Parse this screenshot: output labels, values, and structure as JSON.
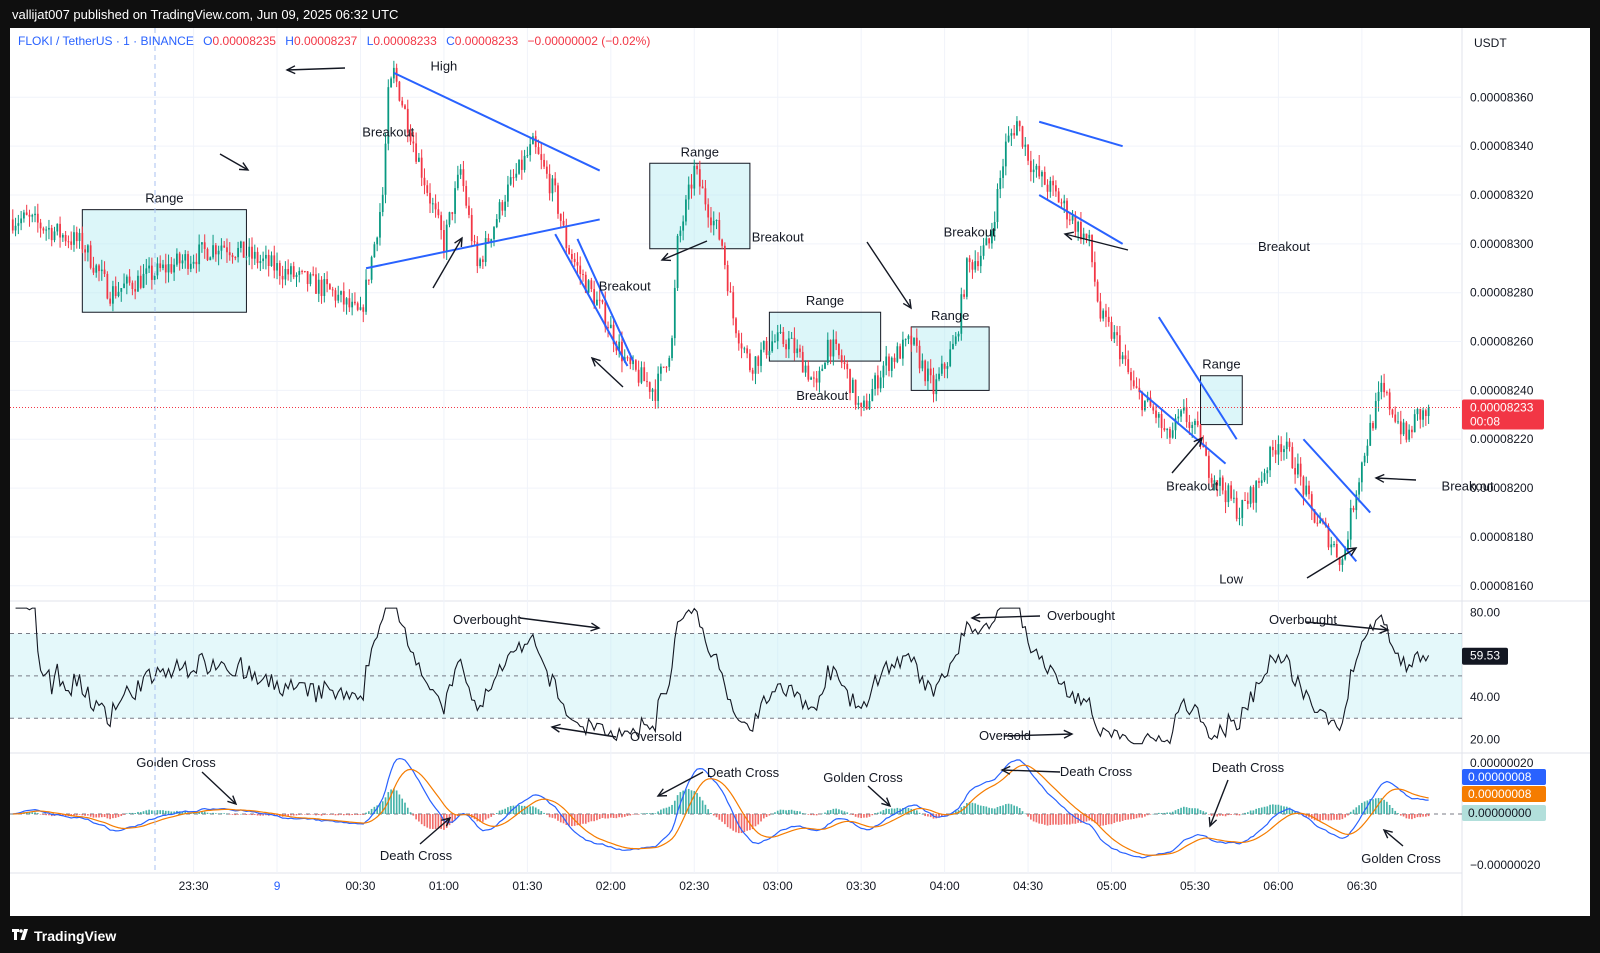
{
  "header": {
    "published_by": "vallijat007 published on TradingView.com, Jun 09, 2025 06:32 UTC"
  },
  "legend": {
    "symbol": "FLOKI / TetherUS · 1 · BINANCE",
    "open_label": "O",
    "open": "0.00008235",
    "high_label": "H",
    "high": "0.00008237",
    "low_label": "L",
    "low": "0.00008233",
    "close_label": "C",
    "close": "0.00008233",
    "change": "−0.00000002 (−0.02%)",
    "up_color": "#089981",
    "down_color": "#f23645",
    "symbol_color": "#2962ff"
  },
  "currency": "USDT",
  "price_badge": {
    "price": "0.00008233",
    "countdown": "00:08",
    "color": "#f23645"
  },
  "rsi_badge": {
    "value": "59.53"
  },
  "macd_badges": [
    {
      "value": "0.00000008",
      "color": "#2962ff"
    },
    {
      "value": "0.00000008",
      "color": "#f57c00"
    },
    {
      "value": "0.00000000",
      "color": "#b2dfdb"
    }
  ],
  "footer": {
    "brand": "TradingView"
  },
  "chart_data": [
    {
      "type": "candlestick",
      "name": "price",
      "y_ticks": [
        "0.00008360",
        "0.00008340",
        "0.00008320",
        "0.00008300",
        "0.00008280",
        "0.00008260",
        "0.00008240",
        "0.00008220",
        "0.00008200",
        "0.00008180",
        "0.00008160"
      ],
      "ylim": [
        8.155e-05,
        8.372e-05
      ],
      "x_ticks": [
        "23:30",
        "9",
        "00:30",
        "01:00",
        "01:30",
        "02:00",
        "02:30",
        "03:00",
        "03:30",
        "04:00",
        "04:30",
        "05:00",
        "05:30",
        "06:00",
        "06:30"
      ],
      "x_tick_minutes": [
        -30,
        0,
        30,
        60,
        90,
        120,
        150,
        180,
        210,
        240,
        270,
        300,
        330,
        360,
        390
      ],
      "last_price": 8.233e-05,
      "path_keypoints": [
        [
          -90,
          8.31e-05
        ],
        [
          -70,
          8.3e-05
        ],
        [
          -60,
          8.28e-05
        ],
        [
          -40,
          8.29e-05
        ],
        [
          -20,
          8.3e-05
        ],
        [
          0,
          8.29e-05
        ],
        [
          20,
          8.28e-05
        ],
        [
          30,
          8.27e-05
        ],
        [
          35,
          8.3e-05
        ],
        [
          38,
          8.32e-05
        ],
        [
          40,
          8.36e-05
        ],
        [
          42,
          8.37e-05
        ],
        [
          52,
          8.33e-05
        ],
        [
          60,
          8.3e-05
        ],
        [
          66,
          8.33e-05
        ],
        [
          72,
          8.29e-05
        ],
        [
          82,
          8.32e-05
        ],
        [
          92,
          8.34e-05
        ],
        [
          100,
          8.32e-05
        ],
        [
          104,
          8.3e-05
        ],
        [
          108,
          8.29e-05
        ],
        [
          118,
          8.27e-05
        ],
        [
          126,
          8.25e-05
        ],
        [
          136,
          8.24e-05
        ],
        [
          142,
          8.26e-05
        ],
        [
          144,
          8.3e-05
        ],
        [
          150,
          8.33e-05
        ],
        [
          160,
          8.3e-05
        ],
        [
          164,
          8.27e-05
        ],
        [
          170,
          8.25e-05
        ],
        [
          178,
          8.26e-05
        ],
        [
          184,
          8.26e-05
        ],
        [
          190,
          8.25e-05
        ],
        [
          194,
          8.24e-05
        ],
        [
          198,
          8.26e-05
        ],
        [
          204,
          8.25e-05
        ],
        [
          210,
          8.23e-05
        ],
        [
          218,
          8.25e-05
        ],
        [
          228,
          8.26e-05
        ],
        [
          236,
          8.24e-05
        ],
        [
          244,
          8.26e-05
        ],
        [
          248,
          8.29e-05
        ],
        [
          256,
          8.3e-05
        ],
        [
          262,
          8.34e-05
        ],
        [
          266,
          8.35e-05
        ],
        [
          272,
          8.33e-05
        ],
        [
          280,
          8.32e-05
        ],
        [
          286,
          8.31e-05
        ],
        [
          292,
          8.3e-05
        ],
        [
          296,
          8.27e-05
        ],
        [
          302,
          8.26e-05
        ],
        [
          308,
          8.24e-05
        ],
        [
          316,
          8.23e-05
        ],
        [
          320,
          8.22e-05
        ],
        [
          326,
          8.23e-05
        ],
        [
          332,
          8.22e-05
        ],
        [
          334,
          8.21e-05
        ],
        [
          340,
          8.2e-05
        ],
        [
          346,
          8.19e-05
        ],
        [
          352,
          8.2e-05
        ],
        [
          360,
          8.22e-05
        ],
        [
          366,
          8.21e-05
        ],
        [
          372,
          8.19e-05
        ],
        [
          378,
          8.18e-05
        ],
        [
          383,
          8.17e-05
        ],
        [
          388,
          8.2e-05
        ],
        [
          392,
          8.22e-05
        ],
        [
          397,
          8.24e-05
        ],
        [
          402,
          8.23e-05
        ],
        [
          406,
          8.22e-05
        ],
        [
          410,
          8.23e-05
        ],
        [
          414,
          8.23e-05
        ]
      ],
      "annotations": [
        {
          "text": "Range",
          "kind": "box",
          "t": [
            -70,
            -11
          ],
          "p": [
            8.272e-05,
            8.314e-05
          ]
        },
        {
          "text": "High",
          "kind": "label",
          "t": 60,
          "p": 8.371e-05
        },
        {
          "text": "Breakout",
          "kind": "label",
          "t": 40,
          "p": 8.344e-05
        },
        {
          "text": "Breakout",
          "kind": "label",
          "t": 125,
          "p": 8.281e-05
        },
        {
          "text": "Range",
          "kind": "box",
          "t": [
            134,
            170
          ],
          "p": [
            8.298e-05,
            8.333e-05
          ]
        },
        {
          "text": "Breakout",
          "kind": "label",
          "t": 180,
          "p": 8.301e-05
        },
        {
          "text": "Breakout",
          "kind": "label",
          "t": 196,
          "p": 8.236e-05
        },
        {
          "text": "Range",
          "kind": "box",
          "t": [
            177,
            217
          ],
          "p": [
            8.252e-05,
            8.272e-05
          ]
        },
        {
          "text": "Breakout",
          "kind": "label",
          "t": 249,
          "p": 8.303e-05
        },
        {
          "text": "Range",
          "kind": "box",
          "t": [
            228,
            256
          ],
          "p": [
            8.24e-05,
            8.266e-05
          ]
        },
        {
          "text": "Breakout",
          "kind": "label",
          "t": 362,
          "p": 8.297e-05
        },
        {
          "text": "Range",
          "kind": "box",
          "t": [
            332,
            347
          ],
          "p": [
            8.226e-05,
            8.246e-05
          ]
        },
        {
          "text": "Breakout",
          "kind": "label",
          "t": 329,
          "p": 8.199e-05
        },
        {
          "text": "Breakout",
          "kind": "label",
          "t": 428,
          "p": 8.199e-05
        },
        {
          "text": "Low",
          "kind": "label",
          "t": 343,
          "p": 8.161e-05
        }
      ],
      "trendlines": [
        [
          [
            42,
            8.37e-05
          ],
          [
            116,
            8.33e-05
          ]
        ],
        [
          [
            32,
            8.29e-05
          ],
          [
            116,
            8.31e-05
          ]
        ],
        [
          [
            100,
            8.304e-05
          ],
          [
            126,
            8.25e-05
          ]
        ],
        [
          [
            108,
            8.302e-05
          ],
          [
            128,
            8.252e-05
          ]
        ],
        [
          [
            274,
            8.35e-05
          ],
          [
            304,
            8.34e-05
          ]
        ],
        [
          [
            274,
            8.32e-05
          ],
          [
            304,
            8.3e-05
          ]
        ],
        [
          [
            317,
            8.27e-05
          ],
          [
            345,
            8.22e-05
          ]
        ],
        [
          [
            310,
            8.24e-05
          ],
          [
            341,
            8.21e-05
          ]
        ],
        [
          [
            369,
            8.22e-05
          ],
          [
            393,
            8.19e-05
          ]
        ],
        [
          [
            366,
            8.2e-05
          ],
          [
            388,
            8.17e-05
          ]
        ]
      ]
    },
    {
      "type": "line",
      "name": "RSI",
      "y_ticks": [
        "80.00",
        "40.00",
        "20.00"
      ],
      "ylim": [
        15,
        83
      ],
      "band": [
        30,
        70
      ],
      "midline": 50,
      "last_value": 59.53,
      "annotations": [
        {
          "text": "Overbought",
          "t": 112
        },
        {
          "text": "Oversold",
          "t": 134
        },
        {
          "text": "Overbought",
          "t": 275
        },
        {
          "text": "Oversold",
          "t": 245
        },
        {
          "text": "Overbought",
          "t": 412
        }
      ]
    },
    {
      "type": "line",
      "name": "MACD",
      "y_ticks": [
        "0.00000020",
        "−0.00000020"
      ],
      "ylim": [
        -2.2e-07,
        2.2e-07
      ],
      "annotations": [
        {
          "text": "Golden Cross",
          "t": 37
        },
        {
          "text": "Death Cross",
          "t": 112
        },
        {
          "text": "Death Cross",
          "t": 178
        },
        {
          "text": "Golden Cross",
          "t": 243
        },
        {
          "text": "Death Cross",
          "t": 310
        },
        {
          "text": "Death Cross",
          "t": 345
        },
        {
          "text": "Golden Cross",
          "t": 421
        }
      ]
    }
  ]
}
